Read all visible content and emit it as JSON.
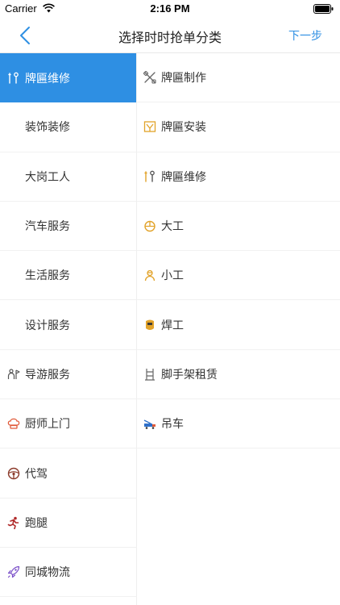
{
  "status_bar": {
    "carrier": "Carrier",
    "time": "2:16 PM"
  },
  "navbar": {
    "title": "选择时时抢单分类",
    "next_label": "下一步"
  },
  "colors": {
    "accent": "#2e8fe3",
    "icon_gray": "#555555",
    "icon_orange": "#e2a32a",
    "icon_red": "#e05a3a"
  },
  "left_categories": [
    {
      "label": "牌匾维修",
      "icon": "wrench-screwdriver-icon",
      "active": true
    },
    {
      "label": "装饰装修",
      "icon": "",
      "active": false
    },
    {
      "label": "大岗工人",
      "icon": "",
      "active": false
    },
    {
      "label": "汽车服务",
      "icon": "",
      "active": false
    },
    {
      "label": "生活服务",
      "icon": "",
      "active": false
    },
    {
      "label": "设计服务",
      "icon": "",
      "active": false
    },
    {
      "label": "导游服务",
      "icon": "tour-guide-icon",
      "active": false
    },
    {
      "label": "厨师上门",
      "icon": "chef-hat-icon",
      "active": false
    },
    {
      "label": "代驾",
      "icon": "steering-wheel-icon",
      "active": false
    },
    {
      "label": "跑腿",
      "icon": "running-man-icon",
      "active": false
    },
    {
      "label": "同城物流",
      "icon": "rocket-icon",
      "active": false
    }
  ],
  "right_subcategories": [
    {
      "label": "牌匾制作",
      "icon": "tools-cross-icon"
    },
    {
      "label": "牌匾安装",
      "icon": "sign-install-icon"
    },
    {
      "label": "牌匾维修",
      "icon": "wrench-screwdriver-icon"
    },
    {
      "label": "大工",
      "icon": "hard-hat-icon"
    },
    {
      "label": "小工",
      "icon": "worker-icon"
    },
    {
      "label": "焊工",
      "icon": "welding-mask-icon"
    },
    {
      "label": "脚手架租赁",
      "icon": "scaffold-icon"
    },
    {
      "label": "吊车",
      "icon": "crane-truck-icon"
    }
  ]
}
